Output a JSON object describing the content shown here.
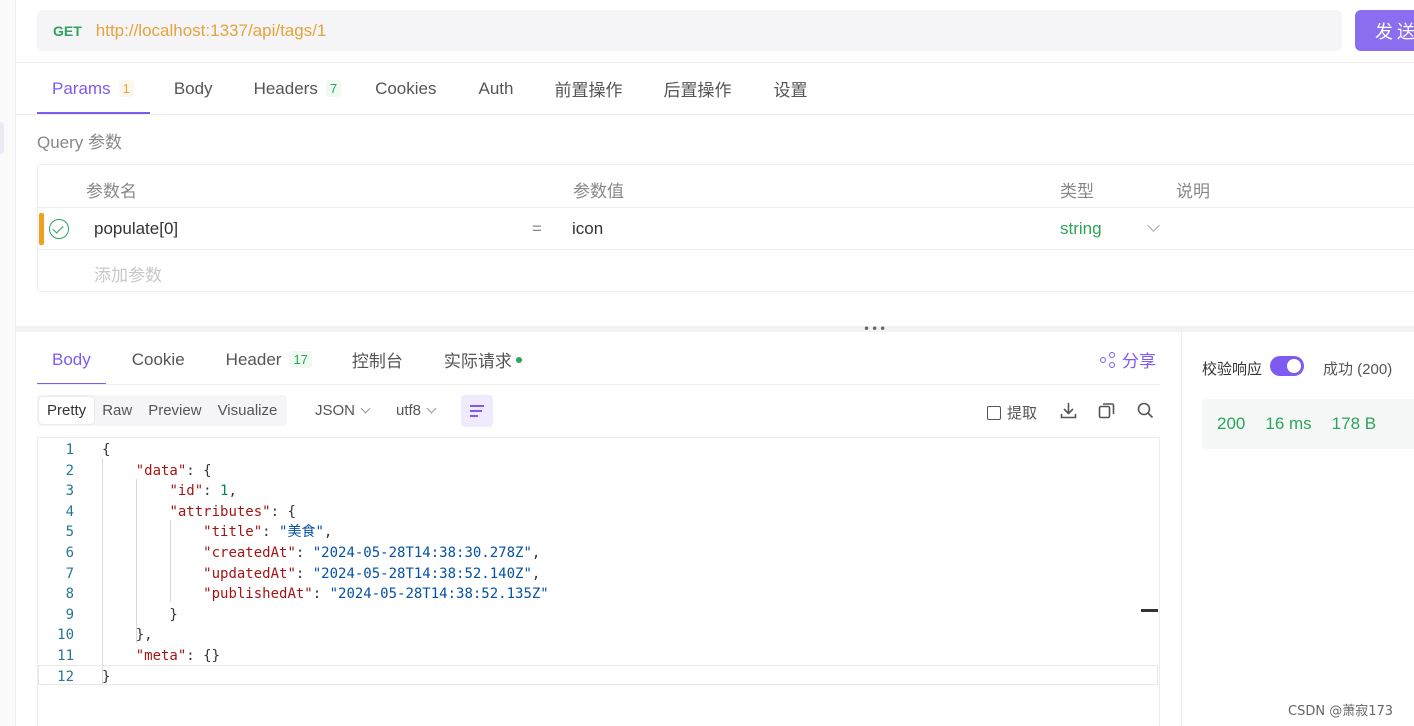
{
  "request": {
    "method": "GET",
    "url": "http://localhost:1337/api/tags/1",
    "send_label": "发送"
  },
  "req_tabs": [
    {
      "label": "Params",
      "badge": "1"
    },
    {
      "label": "Body"
    },
    {
      "label": "Headers",
      "badge": "7"
    },
    {
      "label": "Cookies"
    },
    {
      "label": "Auth"
    },
    {
      "label": "前置操作"
    },
    {
      "label": "后置操作"
    },
    {
      "label": "设置"
    }
  ],
  "query": {
    "title": "Query 参数",
    "columns": {
      "name": "参数名",
      "value": "参数值",
      "type": "类型",
      "desc": "说明"
    },
    "row": {
      "name": "populate[0]",
      "eq": "=",
      "value": "icon",
      "type": "string"
    },
    "add_placeholder": "添加参数"
  },
  "res_tabs": [
    {
      "label": "Body"
    },
    {
      "label": "Cookie"
    },
    {
      "label": "Header",
      "badge": "17"
    },
    {
      "label": "控制台"
    },
    {
      "label": "实际请求"
    }
  ],
  "share_label": "分享",
  "formats": [
    "Pretty",
    "Raw",
    "Preview",
    "Visualize"
  ],
  "selects": {
    "lang": "JSON",
    "encoding": "utf8"
  },
  "tools": {
    "extract": "提取"
  },
  "code_lines": [
    {
      "n": "1",
      "t": "{"
    },
    {
      "n": "2",
      "t": "    \"data\": {"
    },
    {
      "n": "3",
      "t": "        \"id\": 1,"
    },
    {
      "n": "4",
      "t": "        \"attributes\": {"
    },
    {
      "n": "5",
      "t": "            \"title\": \"美食\","
    },
    {
      "n": "6",
      "t": "            \"createdAt\": \"2024-05-28T14:38:30.278Z\","
    },
    {
      "n": "7",
      "t": "            \"updatedAt\": \"2024-05-28T14:38:52.140Z\","
    },
    {
      "n": "8",
      "t": "            \"publishedAt\": \"2024-05-28T14:38:52.135Z\""
    },
    {
      "n": "9",
      "t": "        }"
    },
    {
      "n": "10",
      "t": "    },"
    },
    {
      "n": "11",
      "t": "    \"meta\": {}"
    },
    {
      "n": "12",
      "t": "}"
    }
  ],
  "validation": {
    "label": "校验响应",
    "status": "成功 (200)"
  },
  "stats": {
    "status": "200",
    "time": "16 ms",
    "size": "178 B"
  },
  "watermark": "CSDN @萧寂173",
  "colors": {
    "accent": "#7f5af0",
    "success": "#2aa55a",
    "url": "#e6a23c"
  }
}
